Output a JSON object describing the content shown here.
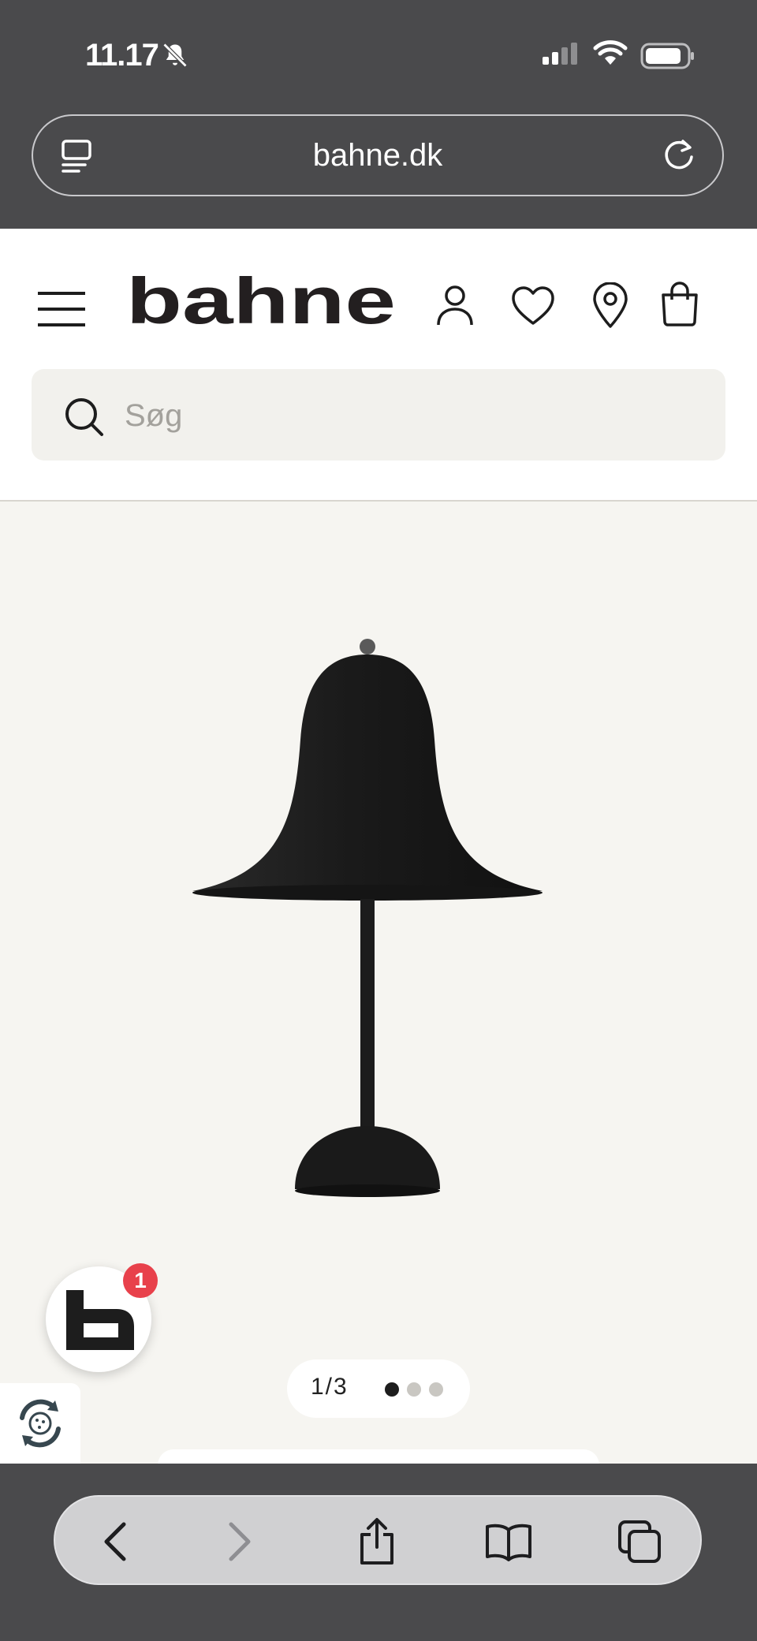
{
  "status_bar": {
    "time": "11.17"
  },
  "browser": {
    "url": "bahne.dk"
  },
  "header": {
    "logo_text": "bahne",
    "search_placeholder": "Søg"
  },
  "product": {
    "pager_text": "1/3",
    "current_image": 1,
    "total_images": 3
  },
  "chat_widget": {
    "badge_count": "1"
  },
  "colors": {
    "browser_chrome": "#4a4a4c",
    "page_bg": "#f6f5f1",
    "search_bg": "#f2f1ed",
    "badge_red": "#e8414b",
    "text_dark": "#222222"
  }
}
